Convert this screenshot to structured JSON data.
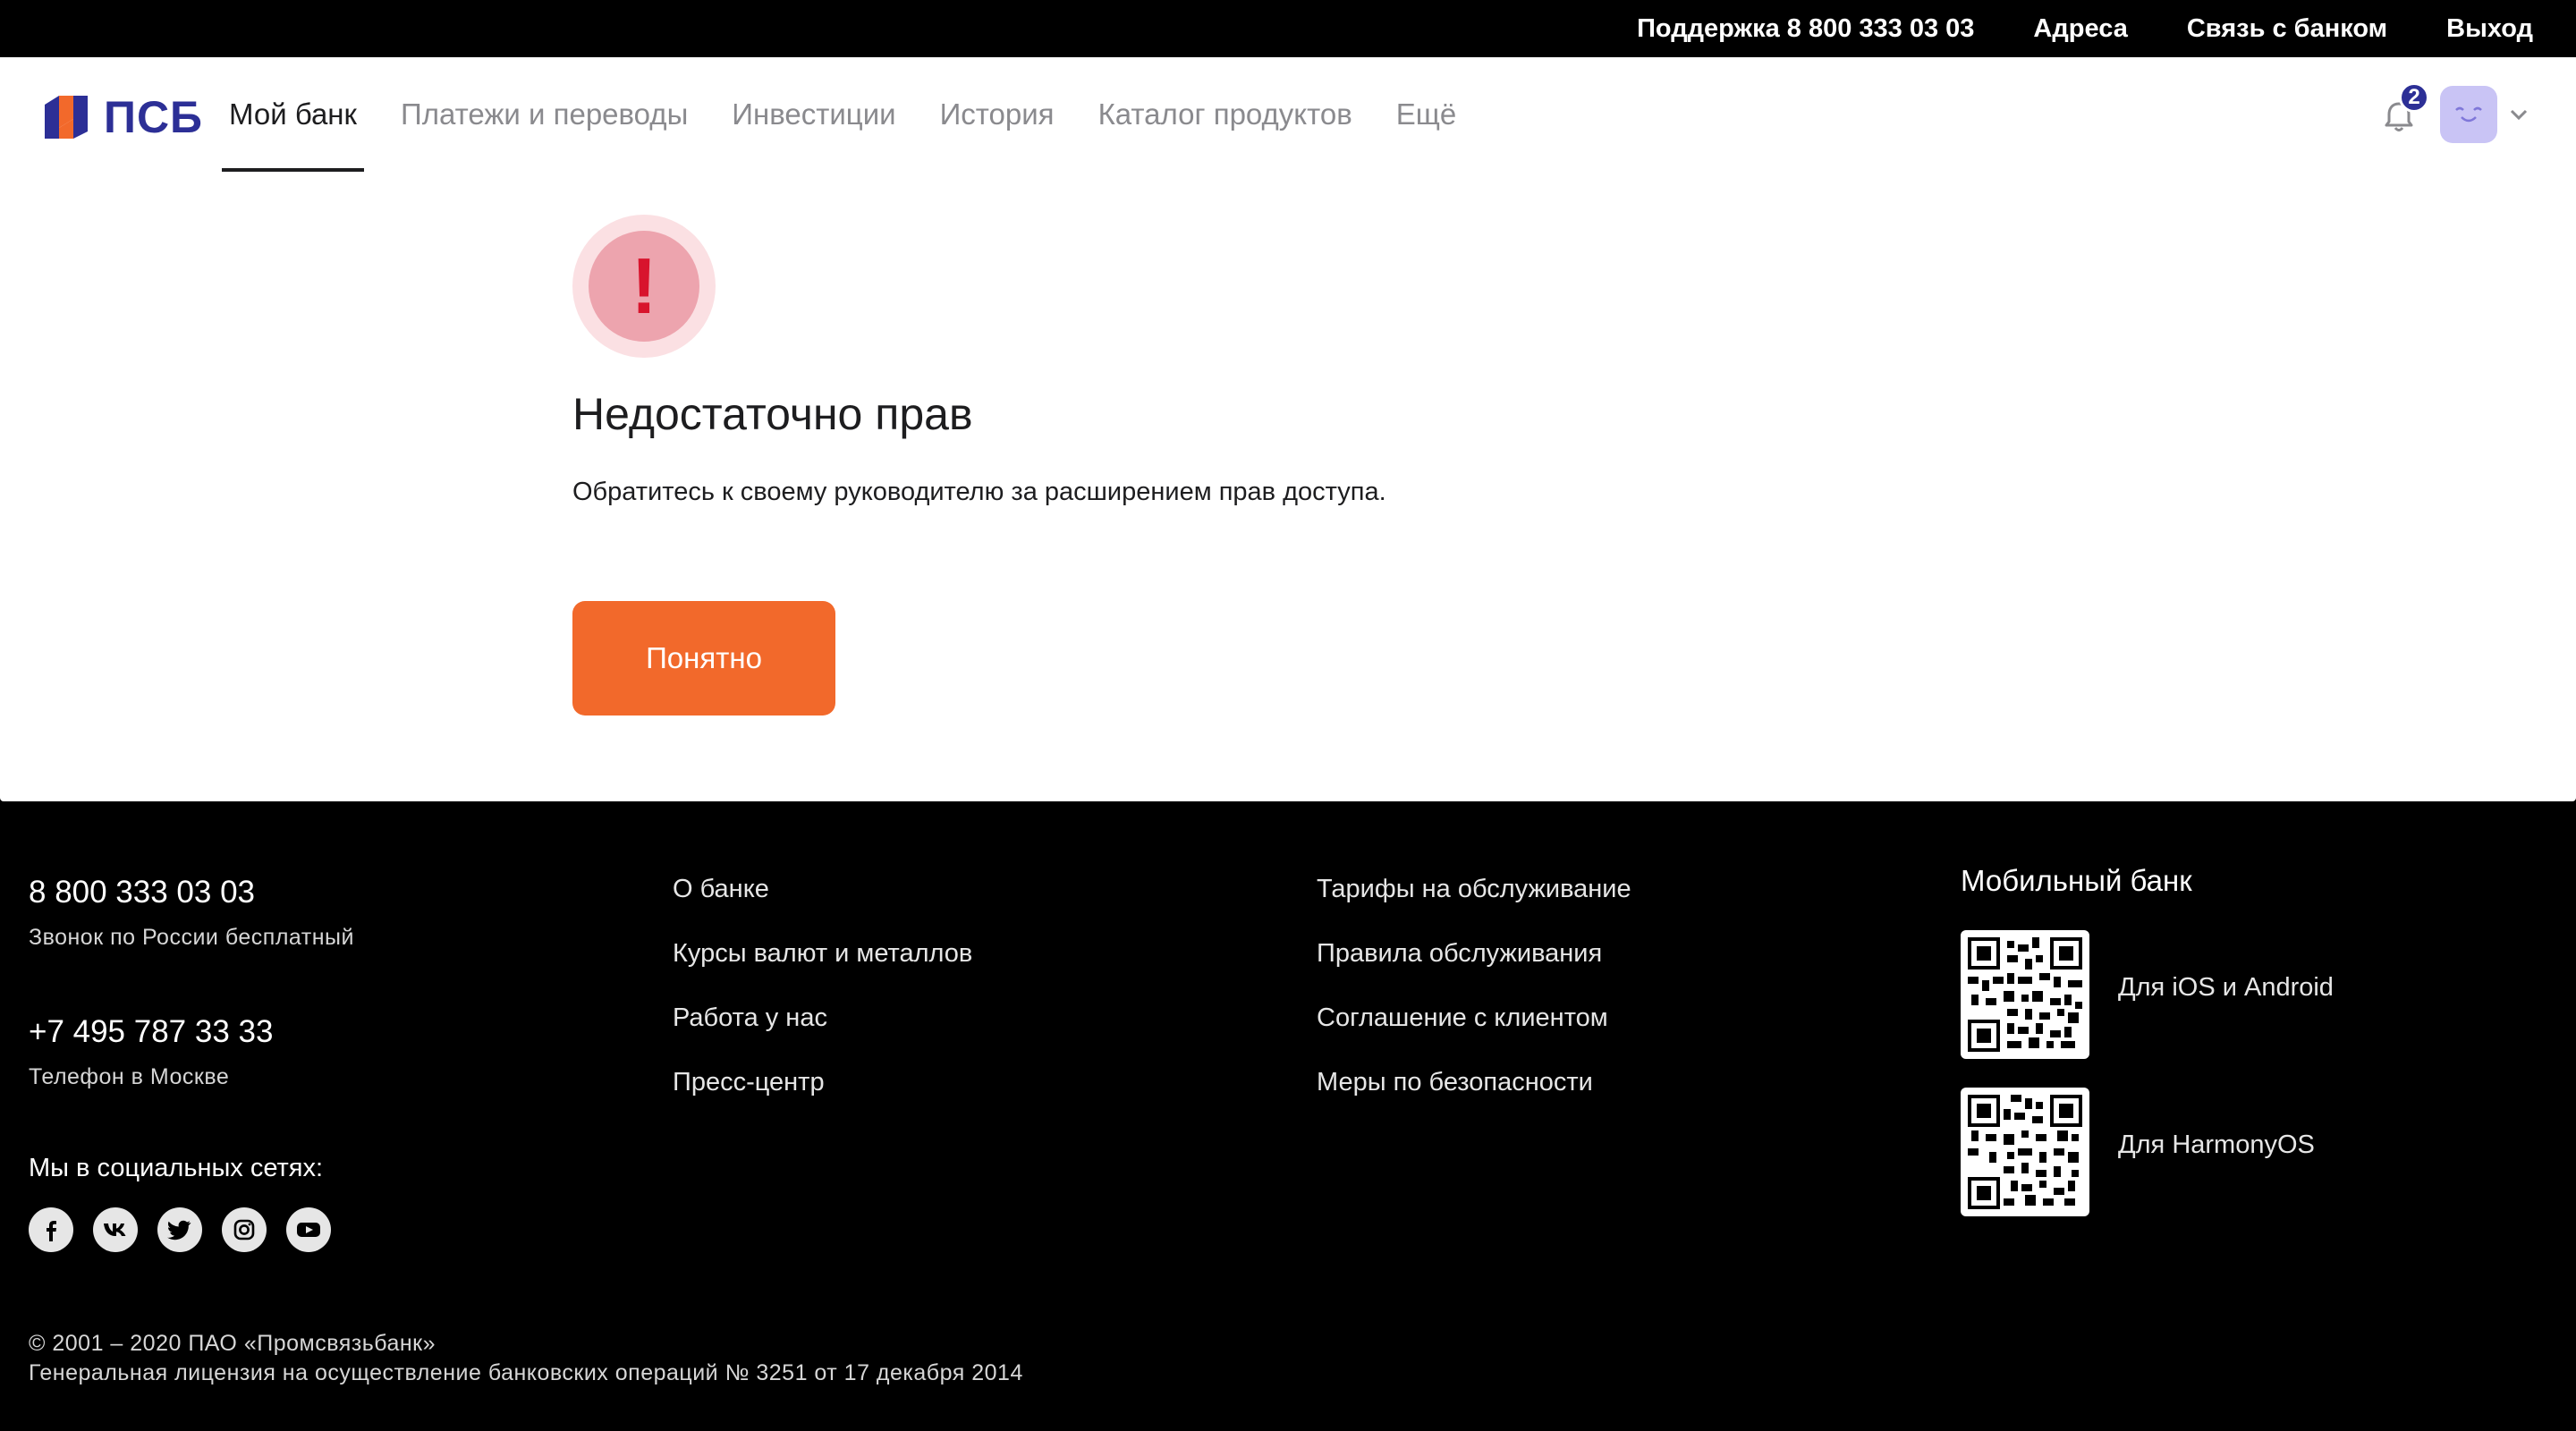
{
  "topbar": {
    "support": "Поддержка 8 800 333 03 03",
    "addresses": "Адреса",
    "contact_bank": "Связь с банком",
    "logout": "Выход"
  },
  "header": {
    "logo_text": "ПСБ",
    "nav": [
      {
        "label": "Мой банк"
      },
      {
        "label": "Платежи и переводы"
      },
      {
        "label": "Инвестиции"
      },
      {
        "label": "История"
      },
      {
        "label": "Каталог продуктов"
      },
      {
        "label": "Ещё"
      }
    ],
    "notification_count": "2",
    "icons": {
      "bell": "bell-icon",
      "avatar": "smiley-avatar-icon",
      "chevron": "chevron-down-icon"
    }
  },
  "error": {
    "icon": "exclamation-icon",
    "title": "Недостаточно прав",
    "message": "Обратитесь к своему руководителю за расширением прав доступа.",
    "button": "Понятно",
    "colors": {
      "accent": "#f2692b",
      "error": "#d8142d"
    }
  },
  "footer": {
    "phone_russia": "8 800 333 03 03",
    "phone_russia_note": "Звонок по России бесплатный",
    "phone_moscow": "+7 495 787 33 33",
    "phone_moscow_note": "Телефон в Москве",
    "social_label": "Мы в социальных сетях:",
    "socials": [
      "facebook-icon",
      "vk-icon",
      "twitter-icon",
      "instagram-icon",
      "youtube-icon"
    ],
    "col1": [
      "О банке",
      "Курсы валют и металлов",
      "Работа у нас",
      "Пресс-центр"
    ],
    "col2": [
      "Тарифы на обслуживание",
      "Правила обслуживания",
      "Соглашение с клиентом",
      "Меры по безопасности"
    ],
    "mobile_title": "Мобильный банк",
    "mobile_ios": "Для iOS и Android",
    "mobile_harmony": "Для HarmonyOS",
    "copyright": "© 2001 – 2020 ПАО «Промсвязьбанк»",
    "license": "Генеральная лицензия на осуществление банковских операций № 3251 от 17 декабря 2014"
  }
}
